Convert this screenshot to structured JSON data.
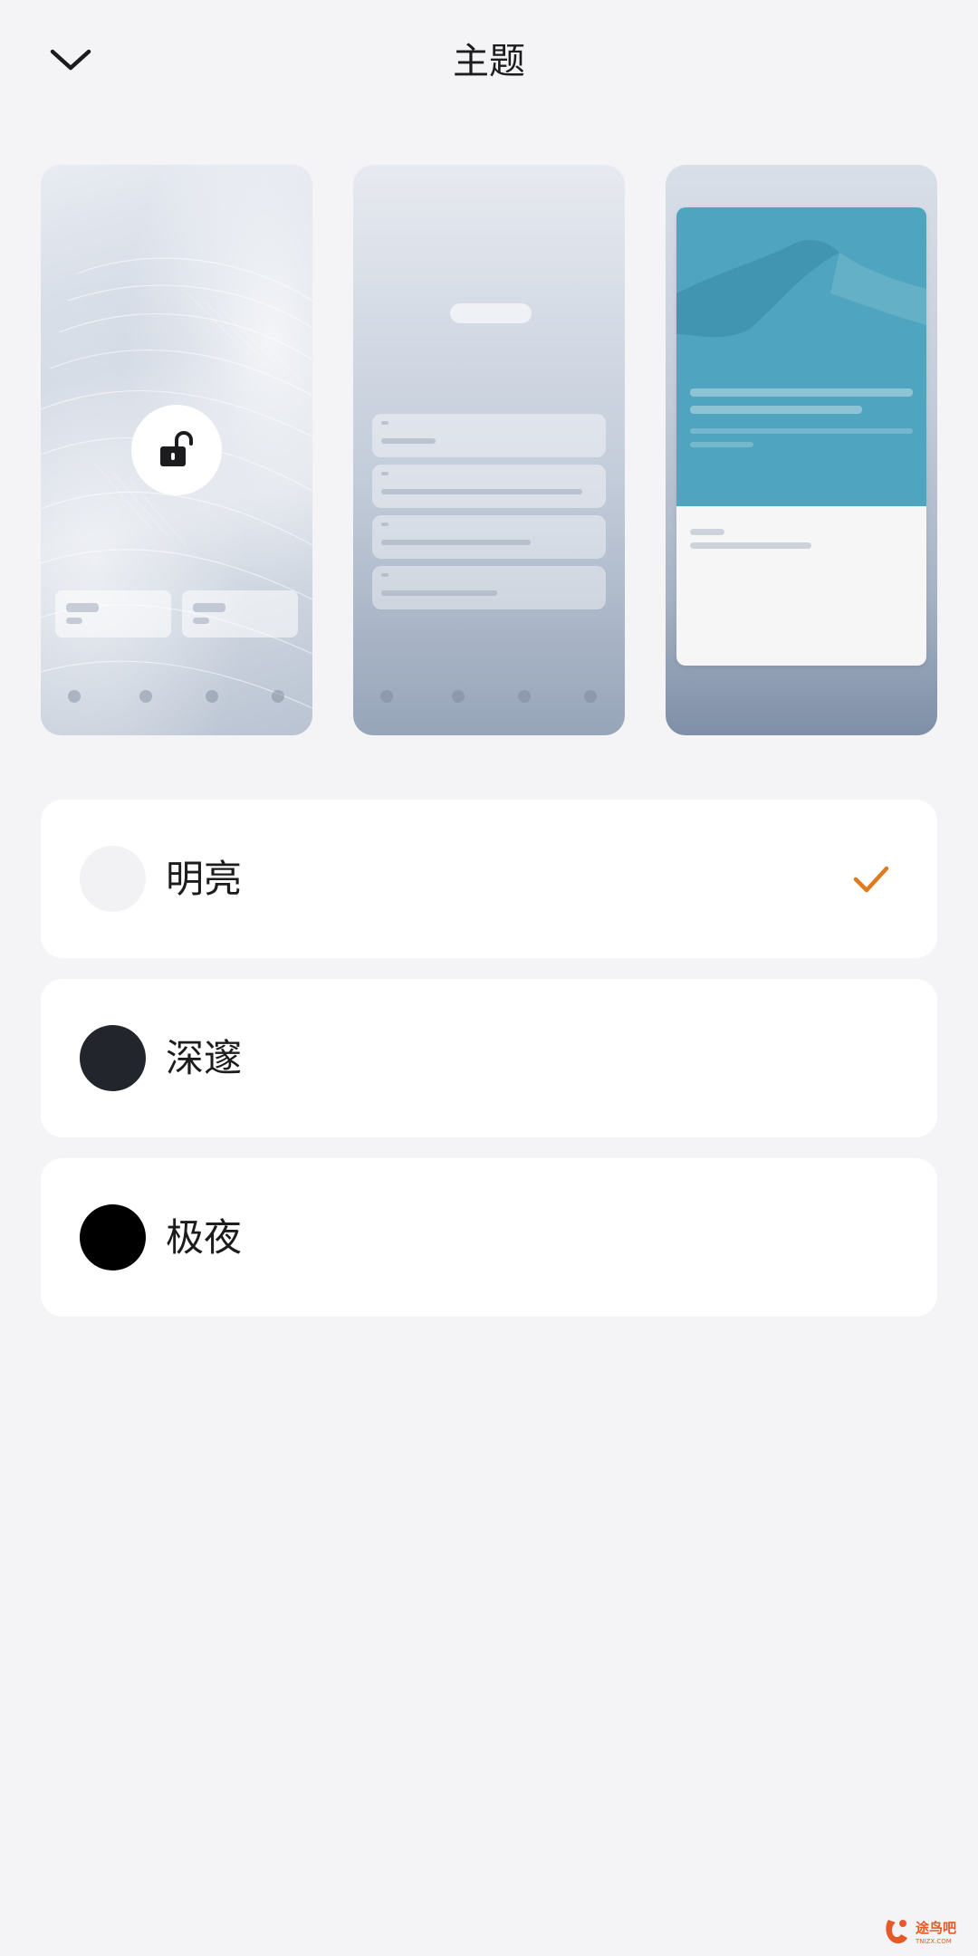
{
  "header": {
    "title": "主题",
    "back_icon": "chevron-down-icon"
  },
  "previews": [
    {
      "name": "lock-screen-preview",
      "lock_icon": "unlock-icon"
    },
    {
      "name": "notification-preview"
    },
    {
      "name": "app-card-preview"
    }
  ],
  "options": [
    {
      "label": "明亮",
      "swatch_color": "#f2f2f4",
      "selected": true
    },
    {
      "label": "深邃",
      "swatch_color": "#22252c",
      "selected": false
    },
    {
      "label": "极夜",
      "swatch_color": "#000000",
      "selected": false
    }
  ],
  "colors": {
    "accent": "#e07a1f",
    "background": "#f4f4f6",
    "card": "#ffffff"
  },
  "watermark": {
    "text": "途鸟吧",
    "subtext": "TNIZX.COM"
  }
}
